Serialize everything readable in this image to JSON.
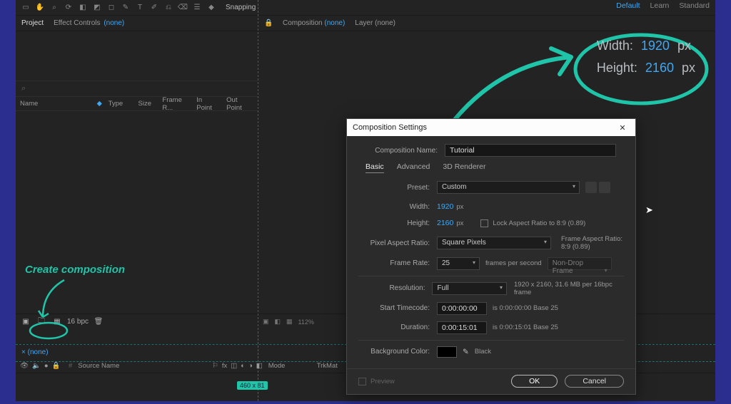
{
  "workspace": {
    "default": "Default",
    "learn": "Learn",
    "standard": "Standard"
  },
  "toolbar": {
    "snapping": "Snapping"
  },
  "panels": {
    "project": "Project",
    "effectControls": "Effect Controls",
    "effectControlsNone": "(none)",
    "composition": "Composition",
    "compositionNone": "(none)",
    "layer": "Layer",
    "layerNone": "(none)"
  },
  "projectHeaders": {
    "name": "Name",
    "type": "Type",
    "size": "Size",
    "frameR": "Frame R...",
    "inPoint": "In Point",
    "outPoint": "Out Point"
  },
  "projectFooter": {
    "bpc": "16 bpc"
  },
  "viewerFooter": {
    "zoom": "112%"
  },
  "timeline": {
    "tab": "(none)",
    "colSource": "Source Name",
    "colMode": "Mode",
    "colTrkMat": "TrkMat"
  },
  "annotations": {
    "createComp": "Create composition",
    "widthLabel": "Width:",
    "widthVal": "1920",
    "widthUnit": "px",
    "heightLabel": "Height:",
    "heightVal": "2160",
    "heightUnit": "px",
    "cropBadge": "460 x 81"
  },
  "dialog": {
    "title": "Composition Settings",
    "compNameLabel": "Composition Name:",
    "compName": "Tutorial",
    "tabBasic": "Basic",
    "tabAdvanced": "Advanced",
    "tab3d": "3D Renderer",
    "presetLabel": "Preset:",
    "presetValue": "Custom",
    "widthLabel": "Width:",
    "widthValue": "1920",
    "widthUnit": "px",
    "heightLabel": "Height:",
    "heightValue": "2160",
    "heightUnit": "px",
    "lockAspect": "Lock Aspect Ratio to 8:9 (0.89)",
    "parLabel": "Pixel Aspect Ratio:",
    "parValue": "Square Pixels",
    "frameAspectLabel": "Frame Aspect Ratio:",
    "frameAspectValue": "8:9 (0.89)",
    "frLabel": "Frame Rate:",
    "frValue": "25",
    "frPer": "frames per second",
    "frDrop": "Non-Drop Frame",
    "resLabel": "Resolution:",
    "resValue": "Full",
    "resInfo": "1920 x 2160, 31.6 MB per 16bpc frame",
    "startTcLabel": "Start Timecode:",
    "startTcValue": "0:00:00:00",
    "startTcInfo": "is 0:00:00:00 Base 25",
    "durLabel": "Duration:",
    "durValue": "0:00:15:01",
    "durInfo": "is 0:00:15:01 Base 25",
    "bgLabel": "Background Color:",
    "bgName": "Black",
    "preview": "Preview",
    "ok": "OK",
    "cancel": "Cancel"
  }
}
